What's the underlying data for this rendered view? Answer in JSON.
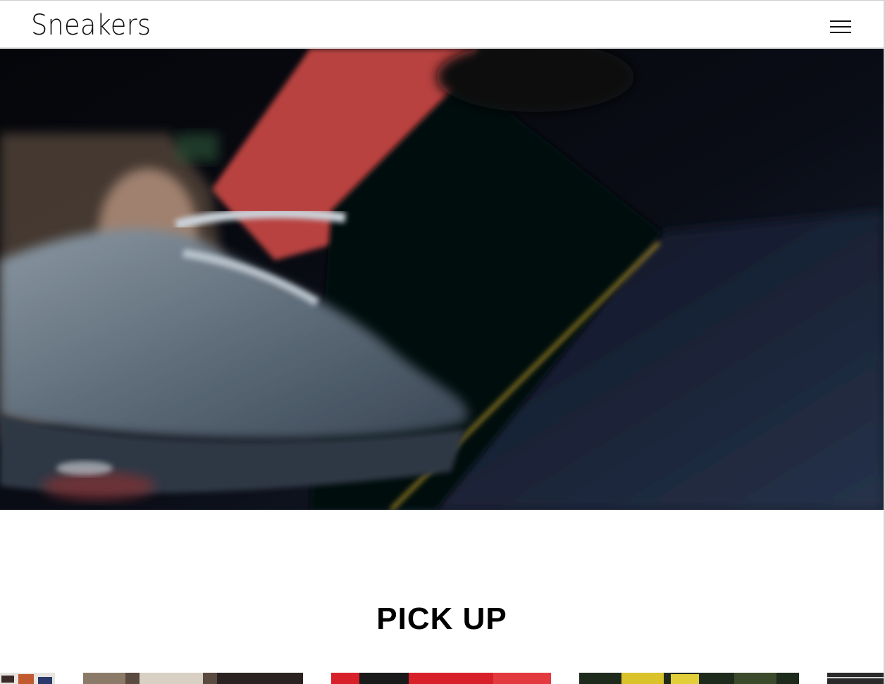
{
  "header": {
    "logo_text": "Sneakers",
    "menu_icon": "hamburger-menu-icon"
  },
  "hero": {
    "media": "sneaker-promo-video"
  },
  "pickup": {
    "title": "PICK UP",
    "cards": [
      {
        "name": "pickup-card-partial-left"
      },
      {
        "name": "pickup-card-1"
      },
      {
        "name": "pickup-card-2"
      },
      {
        "name": "pickup-card-3"
      },
      {
        "name": "pickup-card-partial-right"
      }
    ]
  },
  "colors": {
    "text": "#111111",
    "background": "#ffffff",
    "hero_dark": "#0b0e16",
    "accent_red": "#c0403d",
    "accent_yellow": "#c9a42a"
  }
}
